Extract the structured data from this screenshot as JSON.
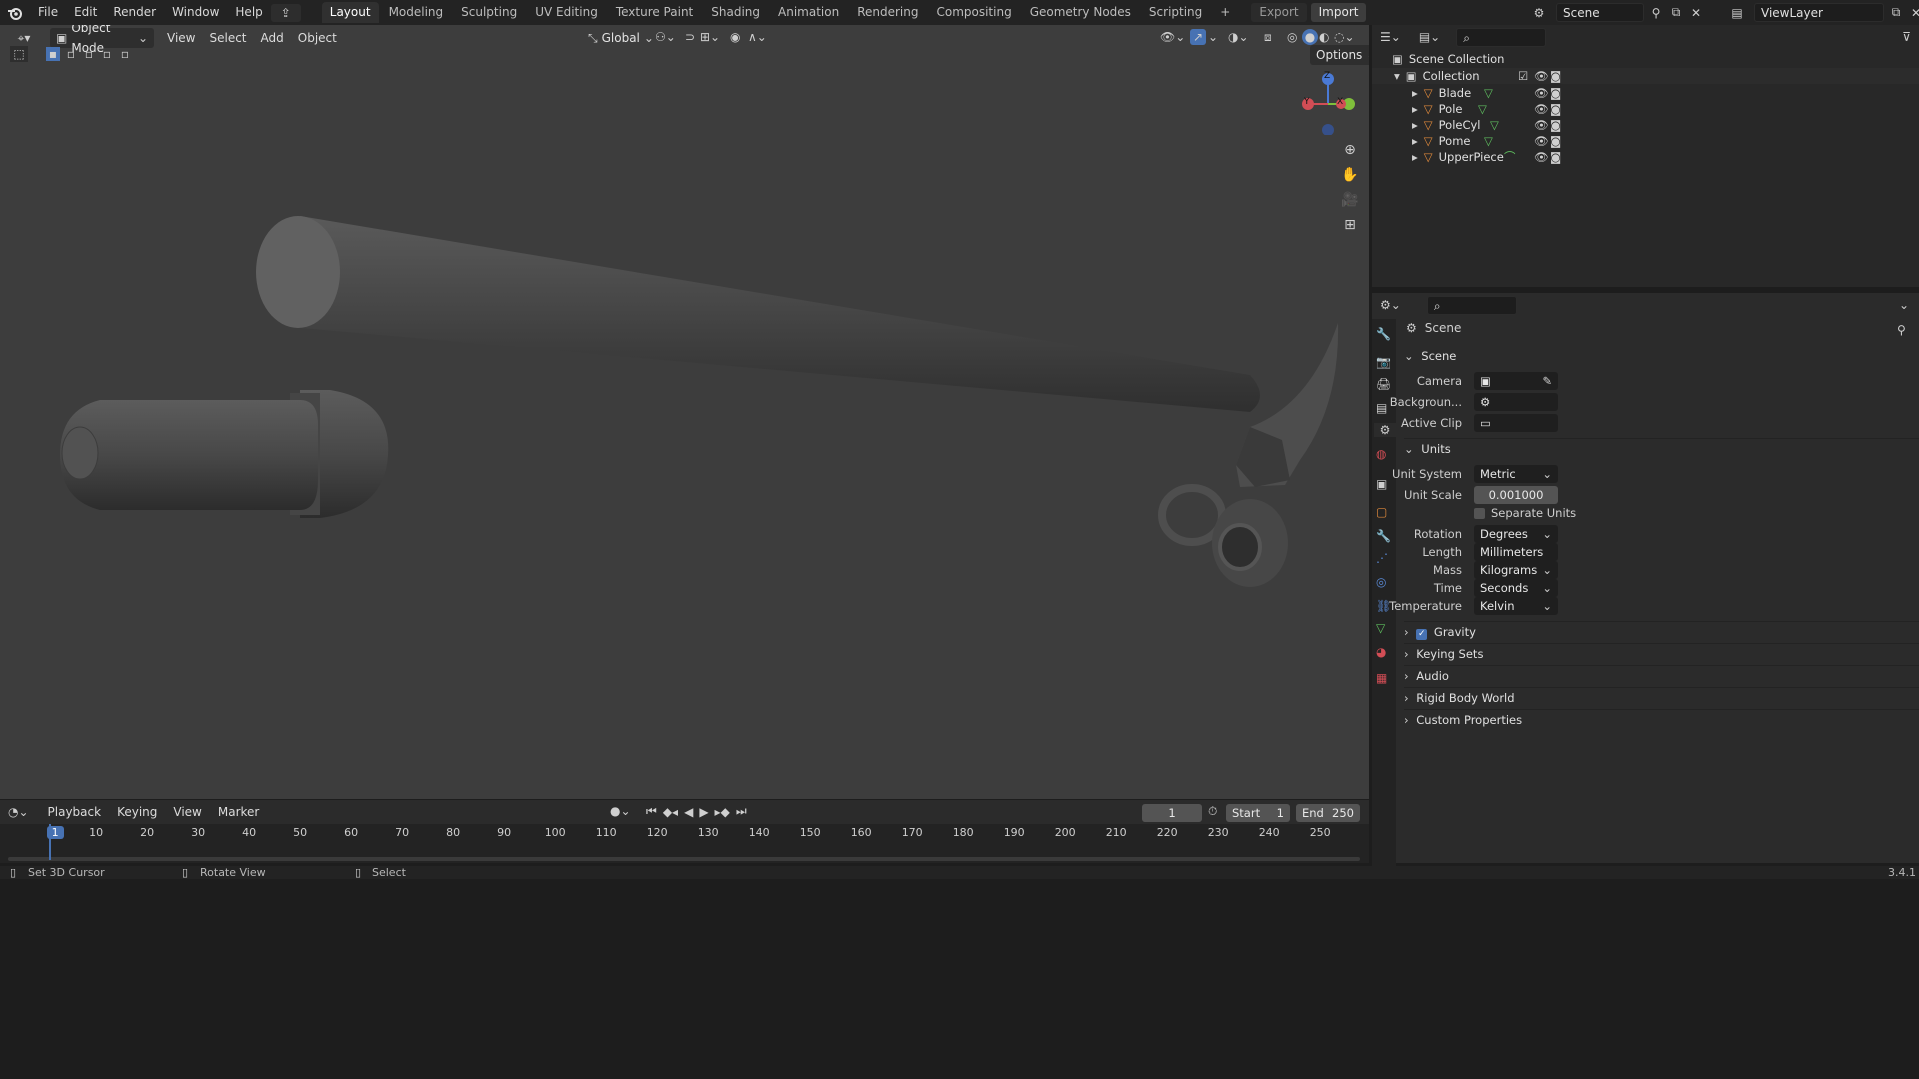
{
  "topbar": {
    "menus": [
      "File",
      "Edit",
      "Render",
      "Window",
      "Help"
    ],
    "workspaces": [
      "Layout",
      "Modeling",
      "Sculpting",
      "UV Editing",
      "Texture Paint",
      "Shading",
      "Animation",
      "Rendering",
      "Compositing",
      "Geometry Nodes",
      "Scripting"
    ],
    "active_workspace": "Layout",
    "add_tab": "+",
    "export_label": "Export",
    "import_label": "Import",
    "scene_name": "Scene",
    "view_layer_name": "ViewLayer"
  },
  "viewport": {
    "mode": "Object Mode",
    "menus": [
      "View",
      "Select",
      "Add",
      "Object"
    ],
    "transform_orientation": "Global",
    "options_label": "Options",
    "gizmo_axes": {
      "z": "Z",
      "y": "Y",
      "x": "X"
    }
  },
  "outliner": {
    "root": "Scene Collection",
    "collection": "Collection",
    "objects": [
      "Blade",
      "Pole",
      "PoleCyl",
      "Pome",
      "UpperPiece"
    ]
  },
  "properties": {
    "context": "Scene",
    "scene_panel": "Scene",
    "camera_label": "Camera",
    "background_label": "Backgroun...",
    "active_clip_label": "Active Clip",
    "units_panel": "Units",
    "unit_system_label": "Unit System",
    "unit_system": "Metric",
    "unit_scale_label": "Unit Scale",
    "unit_scale": "0.001000",
    "separate_units": "Separate Units",
    "rotation_label": "Rotation",
    "rotation": "Degrees",
    "length_label": "Length",
    "length": "Millimeters",
    "mass_label": "Mass",
    "mass": "Kilograms",
    "time_label": "Time",
    "time": "Seconds",
    "temperature_label": "Temperature",
    "temperature": "Kelvin",
    "collapsed_panels": [
      "Gravity",
      "Keying Sets",
      "Audio",
      "Rigid Body World",
      "Custom Properties"
    ],
    "gravity_checked": true
  },
  "timeline": {
    "menus": [
      "Playback",
      "Keying",
      "View",
      "Marker"
    ],
    "current_frame": "1",
    "start_label": "Start",
    "start": "1",
    "end_label": "End",
    "end": "250",
    "ticks": [
      "1",
      "10",
      "20",
      "30",
      "40",
      "50",
      "60",
      "70",
      "80",
      "90",
      "100",
      "110",
      "120",
      "130",
      "140",
      "150",
      "160",
      "170",
      "180",
      "190",
      "200",
      "210",
      "220",
      "230",
      "240",
      "250"
    ]
  },
  "statusbar": {
    "set_cursor": "Set 3D Cursor",
    "rotate_view": "Rotate View",
    "select": "Select",
    "version": "3.4.1"
  },
  "colors": {
    "accent": "#4772b3",
    "viewport_bg": "#3d3d3d",
    "mesh_icon": "#e08a3c",
    "data_icon": "#5fbf5f"
  }
}
